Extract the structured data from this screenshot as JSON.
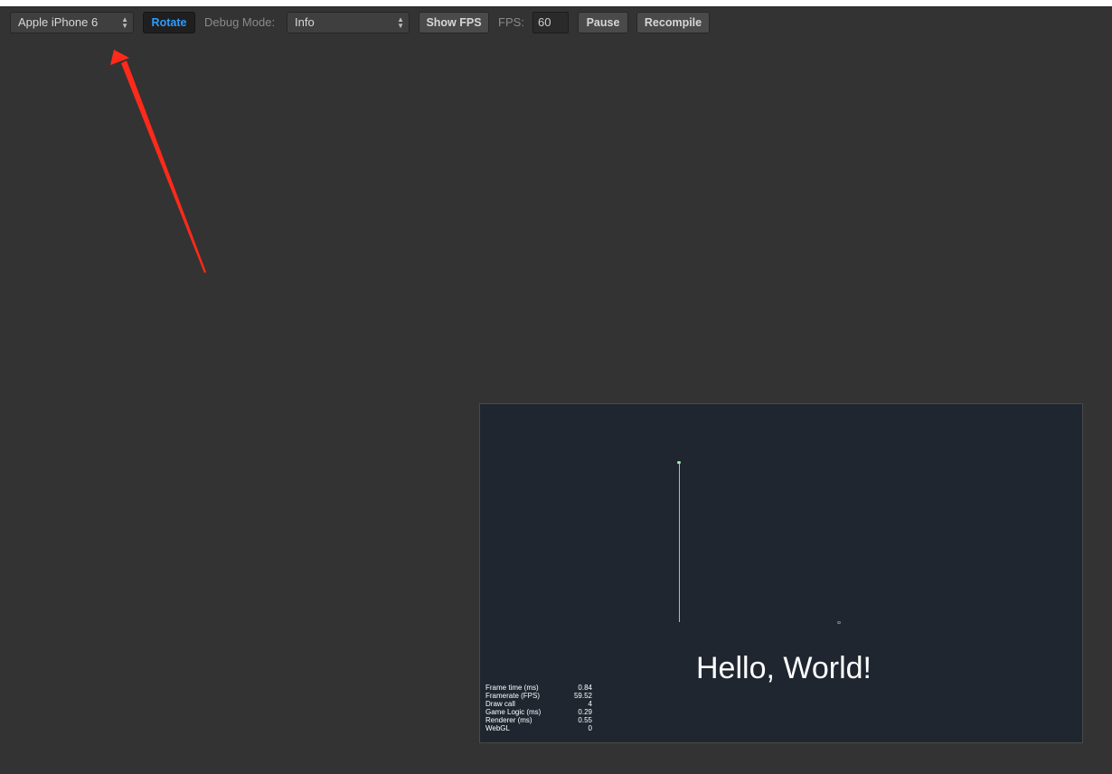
{
  "toolbar": {
    "device": "Apple iPhone 6",
    "rotate_label": "Rotate",
    "debug_mode_label": "Debug Mode:",
    "debug_mode_value": "Info",
    "show_fps_label": "Show FPS",
    "fps_label": "FPS:",
    "fps_value": "60",
    "pause_label": "Pause",
    "recompile_label": "Recompile"
  },
  "annotation": {
    "color": "#ff2a1a"
  },
  "game": {
    "hello_text": "Hello, World!",
    "stats": [
      {
        "label": "Frame time (ms)",
        "value": "0.84"
      },
      {
        "label": "Framerate (FPS)",
        "value": "59.52"
      },
      {
        "label": "Draw call",
        "value": "4"
      },
      {
        "label": "Game Logic (ms)",
        "value": "0.29"
      },
      {
        "label": "Renderer (ms)",
        "value": "0.55"
      },
      {
        "label": "WebGL",
        "value": "0"
      }
    ]
  },
  "colors": {
    "background": "#333333",
    "accent": "#2e9bff",
    "game_background": "#1f2630"
  }
}
